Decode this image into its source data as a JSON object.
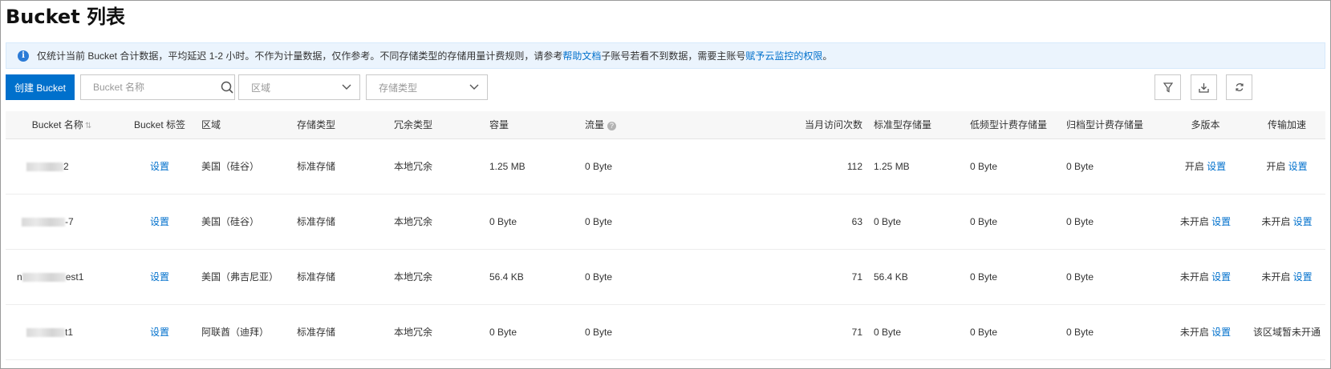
{
  "page": {
    "title": "Bucket 列表"
  },
  "notice": {
    "text_before": "仅统计当前 Bucket 合计数据，平均延迟 1-2 小时。不作为计量数据，仅作参考。不同存储类型的存储用量计费规则，请参考",
    "link1": "帮助文档",
    "text_middle": " 子账号若看不到数据，需要主账号",
    "link2": "赋予云监控的权限",
    "text_after": "。"
  },
  "toolbar": {
    "create_label": "创建 Bucket",
    "search_placeholder": "Bucket 名称",
    "region_select": "区域",
    "storage_select": "存储类型"
  },
  "table": {
    "headers": [
      "Bucket 名称",
      "Bucket 标签",
      "区域",
      "存储类型",
      "冗余类型",
      "容量",
      "流量",
      "当月访问次数",
      "标准型存储量",
      "低频型计费存储量",
      "归档型计费存储量",
      "多版本",
      "传输加速"
    ],
    "rows": [
      {
        "name_suffix": "2",
        "tag": "设置",
        "region": "美国（硅谷）",
        "storage": "标准存储",
        "redundancy": "本地冗余",
        "capacity": "1.25 MB",
        "traffic": "0 Byte",
        "visits": "112",
        "standard": "1.25 MB",
        "ia": "0 Byte",
        "archive": "0 Byte",
        "versioning_status": "开启",
        "versioning_link": "设置",
        "accel_status": "开启",
        "accel_link": "设置"
      },
      {
        "name_suffix": "-7",
        "tag": "设置",
        "region": "美国（硅谷）",
        "storage": "标准存储",
        "redundancy": "本地冗余",
        "capacity": "0 Byte",
        "traffic": "0 Byte",
        "visits": "63",
        "standard": "0 Byte",
        "ia": "0 Byte",
        "archive": "0 Byte",
        "versioning_status": "未开启",
        "versioning_link": "设置",
        "accel_status": "未开启",
        "accel_link": "设置"
      },
      {
        "name_prefix": "n",
        "name_suffix": "est1",
        "tag": "设置",
        "region": "美国（弗吉尼亚）",
        "storage": "标准存储",
        "redundancy": "本地冗余",
        "capacity": "56.4 KB",
        "traffic": "0 Byte",
        "visits": "71",
        "standard": "56.4 KB",
        "ia": "0 Byte",
        "archive": "0 Byte",
        "versioning_status": "未开启",
        "versioning_link": "设置",
        "accel_status": "未开启",
        "accel_link": "设置"
      },
      {
        "name_suffix": "t1",
        "tag": "设置",
        "region": "阿联酋（迪拜）",
        "storage": "标准存储",
        "redundancy": "本地冗余",
        "capacity": "0 Byte",
        "traffic": "0 Byte",
        "visits": "71",
        "standard": "0 Byte",
        "ia": "0 Byte",
        "archive": "0 Byte",
        "versioning_status": "未开启",
        "versioning_link": "设置",
        "accel_text": "该区域暂未开通"
      }
    ]
  }
}
